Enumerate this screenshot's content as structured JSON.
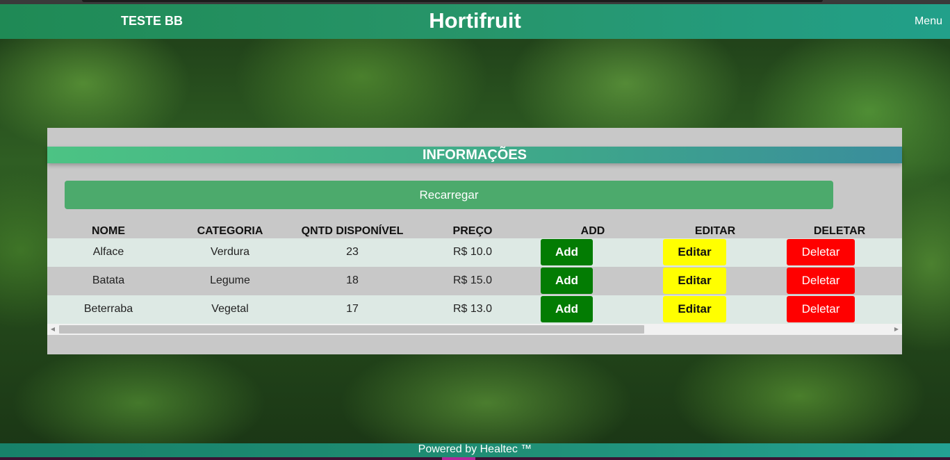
{
  "navbar": {
    "brand": "TESTE BB",
    "title": "Hortifruit",
    "menu_label": "Menu"
  },
  "panel": {
    "header": "INFORMAÇÕES",
    "reload_label": "Recarregar"
  },
  "table": {
    "columns": [
      "NOME",
      "CATEGORIA",
      "QNTD DISPONÍVEL",
      "PREÇO",
      "ADD",
      "EDITAR",
      "DELETAR"
    ],
    "rows": [
      {
        "nome": "Alface",
        "categoria": "Verdura",
        "qntd": "23",
        "preco": "R$ 10.0",
        "add": "Add",
        "editar": "Editar",
        "deletar": "Deletar"
      },
      {
        "nome": "Batata",
        "categoria": "Legume",
        "qntd": "18",
        "preco": "R$ 15.0",
        "add": "Add",
        "editar": "Editar",
        "deletar": "Deletar"
      },
      {
        "nome": "Beterraba",
        "categoria": "Vegetal",
        "qntd": "17",
        "preco": "R$ 13.0",
        "add": "Add",
        "editar": "Editar",
        "deletar": "Deletar"
      }
    ]
  },
  "footer": {
    "text": "Powered by Healtec ™"
  },
  "icons": {
    "scroll_left": "scroll-left-arrow-icon",
    "scroll_right": "scroll-right-arrow-icon"
  },
  "colors": {
    "add_button": "#037c03",
    "edit_button": "#ffff00",
    "delete_button": "#ff0000",
    "reload_button": "#4caa6c"
  }
}
